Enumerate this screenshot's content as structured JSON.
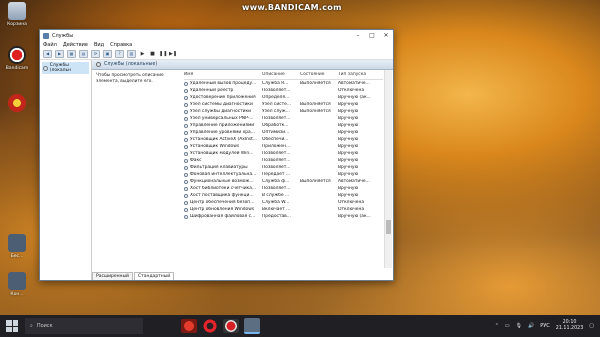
{
  "watermark": "www.BANDICAM.com",
  "desktop": {
    "recycle_bin": "Корзина",
    "bandicam": "Bandicam",
    "icon3_label": "",
    "icon4_label": "Бес...",
    "icon5_label": "Кон..."
  },
  "window": {
    "title": "Службы",
    "menu": [
      "Файл",
      "Действие",
      "Вид",
      "Справка"
    ],
    "tree_root": "Службы (локальн",
    "header": "Службы (локальные)",
    "description": "Чтобы просмотреть описание элемента, выделите его.",
    "columns": [
      "Имя",
      "Описание",
      "Состояние",
      "Тип запуска"
    ],
    "rows": [
      [
        "Удаленный вызов процеду...",
        "Служба R...",
        "Выполняется",
        "Автоматиче..."
      ],
      [
        "Удаленный реестр",
        "Позволяет...",
        "",
        "Отключена"
      ],
      [
        "Удостоверение приложения",
        "Определя...",
        "",
        "Вручную (ак..."
      ],
      [
        "Узел системы диагностики",
        "Узел систе...",
        "Выполняется",
        "Вручную"
      ],
      [
        "Узел службы диагностики",
        "Узел служ...",
        "Выполняется",
        "Вручную"
      ],
      [
        "Узел универсальных PNP-...",
        "Позволяет...",
        "",
        "Вручную"
      ],
      [
        "Управление приложениями",
        "Обработк...",
        "",
        "Вручную"
      ],
      [
        "Управление уровнями хра...",
        "Оптимизи...",
        "",
        "Вручную"
      ],
      [
        "Установщик ActiveX (AxInst...",
        "Обеспечи...",
        "",
        "Вручную"
      ],
      [
        "Установщик Windows",
        "Приложен...",
        "",
        "Вручную"
      ],
      [
        "Установщик модулей Win...",
        "Позволяет...",
        "",
        "Вручную"
      ],
      [
        "Факс",
        "Позволяет...",
        "",
        "Вручную"
      ],
      [
        "Фильтрация клавиатуры",
        "Позволяет...",
        "",
        "Вручную"
      ],
      [
        "Фоновая интеллектуальна...",
        "Передает ...",
        "",
        "Вручную"
      ],
      [
        "Функциональные возмож...",
        "Служба ф...",
        "Выполняется",
        "Автоматиче..."
      ],
      [
        "Хост библиотеки счетчика...",
        "Позволяет...",
        "",
        "Вручную"
      ],
      [
        "Хост поставщика функци...",
        "В службе ...",
        "",
        "Вручную"
      ],
      [
        "Центр обеспечения безоп...",
        "Служба W...",
        "",
        "Отключена"
      ],
      [
        "Центр обновления Windows",
        "Включает ...",
        "",
        "Отключена"
      ],
      [
        "Шифрованная файловая с...",
        "Предостав...",
        "",
        "Вручную (ак..."
      ]
    ],
    "tabs": [
      "Расширенный",
      "Стандартный"
    ]
  },
  "taskbar": {
    "search_placeholder": "Поиск",
    "language": "РУС",
    "time": "20:10",
    "date": "21.11.2023"
  }
}
